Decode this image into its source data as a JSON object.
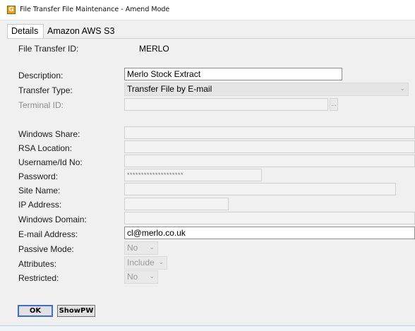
{
  "window": {
    "title": "File Transfer File Maintenance - Amend Mode",
    "icon_letter": "G"
  },
  "tabs": [
    {
      "label": "Details"
    },
    {
      "label": "Amazon AWS S3"
    }
  ],
  "form": {
    "file_transfer_id": {
      "label": "File Transfer ID:",
      "value": "MERLO"
    },
    "description": {
      "label": "Description:",
      "value": "Merlo Stock Extract"
    },
    "transfer_type": {
      "label": "Transfer Type:",
      "value": "Transfer File by E-mail"
    },
    "terminal_id": {
      "label": "Terminal ID:",
      "value": "",
      "button": "..."
    },
    "windows_share": {
      "label": "Windows Share:",
      "value": ""
    },
    "rsa_location": {
      "label": "RSA Location:",
      "value": ""
    },
    "username": {
      "label": "Username/Id No:",
      "value": ""
    },
    "password": {
      "label": "Password:",
      "value": "********************"
    },
    "site_name": {
      "label": "Site Name:",
      "value": ""
    },
    "ip_address": {
      "label": "IP Address:",
      "value": ""
    },
    "windows_domain": {
      "label": "Windows Domain:",
      "value": ""
    },
    "email_address": {
      "label": "E-mail Address:",
      "value": "cl@merlo.co.uk"
    },
    "passive_mode": {
      "label": "Passive Mode:",
      "value": "No"
    },
    "attributes": {
      "label": "Attributes:",
      "value": "Include"
    },
    "restricted": {
      "label": "Restricted:",
      "value": "No"
    }
  },
  "buttons": {
    "ok": "OK",
    "show_pw": "ShowPW"
  },
  "icons": {
    "dropdown": "chevron-down-icon",
    "app": "app-icon"
  },
  "colors": {
    "focus_border": "#3c6fd6",
    "app_icon": "#e8a317"
  }
}
